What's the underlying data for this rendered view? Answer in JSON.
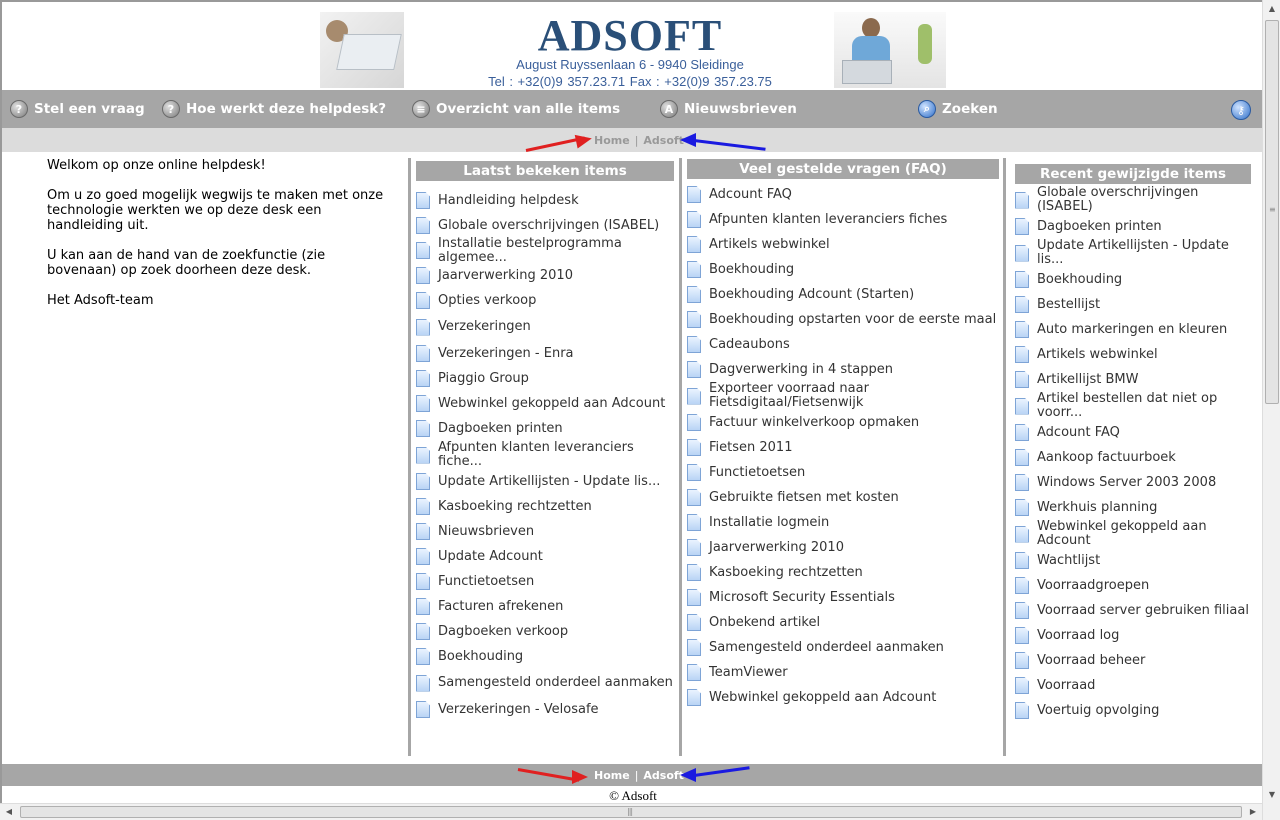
{
  "banner": {
    "brand": "ADSOFT",
    "address": "August Ruyssenlaan 6 - 9940 Sleidinge",
    "contact": "Tel : +32(0)9 357.23.71    Fax : +32(0)9 357.23.75"
  },
  "nav": {
    "ask": "Stel een vraag",
    "how": "Hoe werkt deze helpdesk?",
    "overview": "Overzicht van alle items",
    "newsletters": "Nieuwsbrieven",
    "search": "Zoeken",
    "ask_icon": "question-icon",
    "how_icon": "question-icon",
    "overview_icon": "list-icon",
    "newsletters_icon": "newsletter-icon",
    "search_icon": "search-icon",
    "admin_icon": "key-icon"
  },
  "breadcrumb": {
    "home": "Home",
    "separator": "|",
    "current": "Adsoft"
  },
  "annotation_colors": {
    "red_arrow": "#e02020",
    "blue_arrow": "#1a1ae0"
  },
  "welcome": {
    "line1": "Welkom op onze online helpdesk!",
    "line2": "Om u zo goed mogelijk wegwijs te maken met onze technologie werkten we op deze desk een handleiding uit.",
    "line3": "U kan aan de hand van de zoekfunctie (zie bovenaan) op zoek doorheen deze desk.",
    "line4": "Het Adsoft-team"
  },
  "columns": {
    "recent_viewed": {
      "title": "Laatst bekeken items",
      "items": [
        "Handleiding helpdesk",
        "Globale overschrijvingen (ISABEL)",
        "Installatie bestelprogramma algemee...",
        "Jaarverwerking 2010",
        "Opties verkoop",
        "Verzekeringen",
        "Verzekeringen - Enra",
        "Piaggio Group",
        "Webwinkel gekoppeld aan Adcount",
        "Dagboeken printen",
        "Afpunten klanten leveranciers fiche...",
        "Update Artikellijsten - Update lis...",
        "Kasboeking rechtzetten",
        "Nieuwsbrieven",
        "Update Adcount",
        "Functietoetsen",
        "Facturen afrekenen",
        "Dagboeken verkoop",
        "Boekhouding",
        "Samengesteld onderdeel aanmaken",
        "Verzekeringen - Velosafe"
      ]
    },
    "faq": {
      "title": "Veel gestelde vragen (FAQ)",
      "items": [
        "Adcount FAQ",
        "Afpunten klanten leveranciers fiches",
        "Artikels webwinkel",
        "Boekhouding",
        "Boekhouding Adcount (Starten)",
        "Boekhouding opstarten voor de eerste maal",
        "Cadeaubons",
        "Dagverwerking in 4 stappen",
        "Exporteer voorraad naar Fietsdigitaal/Fietsenwijk",
        "Factuur winkelverkoop opmaken",
        "Fietsen 2011",
        "Functietoetsen",
        "Gebruikte fietsen met kosten",
        "Installatie logmein",
        "Jaarverwerking 2010",
        "Kasboeking rechtzetten",
        "Microsoft Security Essentials",
        "Onbekend artikel",
        "Samengesteld onderdeel aanmaken",
        "TeamViewer",
        "Webwinkel gekoppeld aan Adcount"
      ]
    },
    "recent_changed": {
      "title": "Recent gewijzigde items",
      "items": [
        "Globale overschrijvingen (ISABEL)",
        "Dagboeken printen",
        "Update Artikellijsten - Update lis...",
        "Boekhouding",
        "Bestellijst",
        "Auto markeringen en kleuren",
        "Artikels webwinkel",
        "Artikellijst BMW",
        "Artikel bestellen dat niet op voorr...",
        "Adcount FAQ",
        "Aankoop factuurboek",
        "Windows Server 2003 2008",
        "Werkhuis planning",
        "Webwinkel gekoppeld aan Adcount",
        "Wachtlijst",
        "Voorraadgroepen",
        "Voorraad server gebruiken filiaal",
        "Voorraad log",
        "Voorraad beheer",
        "Voorraad",
        "Voertuig opvolging"
      ]
    }
  },
  "footer": {
    "copyright": "© Adsoft"
  }
}
